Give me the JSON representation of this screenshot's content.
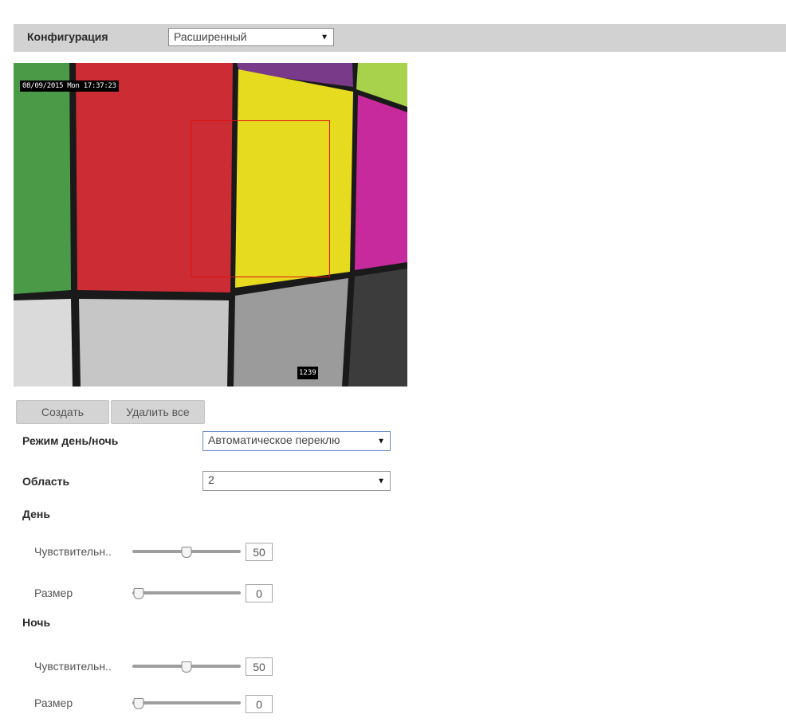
{
  "header": {
    "title": "Конфигурация",
    "mode_select": "Расширенный"
  },
  "video": {
    "osd_datetime": "08/09/2015 Mon 17:37:23",
    "osd_code": "1239"
  },
  "buttons": {
    "create": "Создать",
    "delete_all": "Удалить все"
  },
  "day_night": {
    "label": "Режим день/ночь",
    "value": "Автоматическое переклю"
  },
  "region": {
    "label": "Область",
    "value": "2"
  },
  "day": {
    "heading": "День",
    "sensitivity_label": "Чувствительн..",
    "sensitivity_value": 50,
    "size_label": "Размер",
    "size_value": 0
  },
  "night": {
    "heading": "Ночь",
    "sensitivity_label": "Чувствительн..",
    "sensitivity_value": 50,
    "size_label": "Размер",
    "size_value": 0
  },
  "icons": {
    "dropdown_arrow": "▼"
  }
}
